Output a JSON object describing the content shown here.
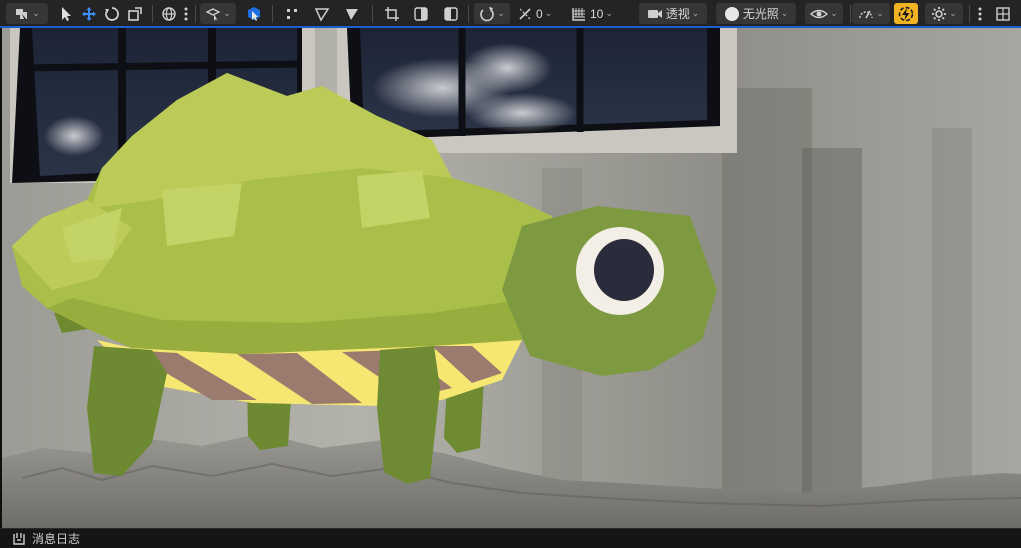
{
  "toolbar": {
    "snap_angle_value": "0",
    "grid_value": "10",
    "view_mode_label": "透视",
    "lighting_label": "无光照"
  },
  "statusbar": {
    "message_log_label": "消息日志"
  },
  "colors": {
    "accent_blue": "#1d5fd0",
    "active_yellow": "#f1b321",
    "toolbar_bg": "#242424"
  }
}
